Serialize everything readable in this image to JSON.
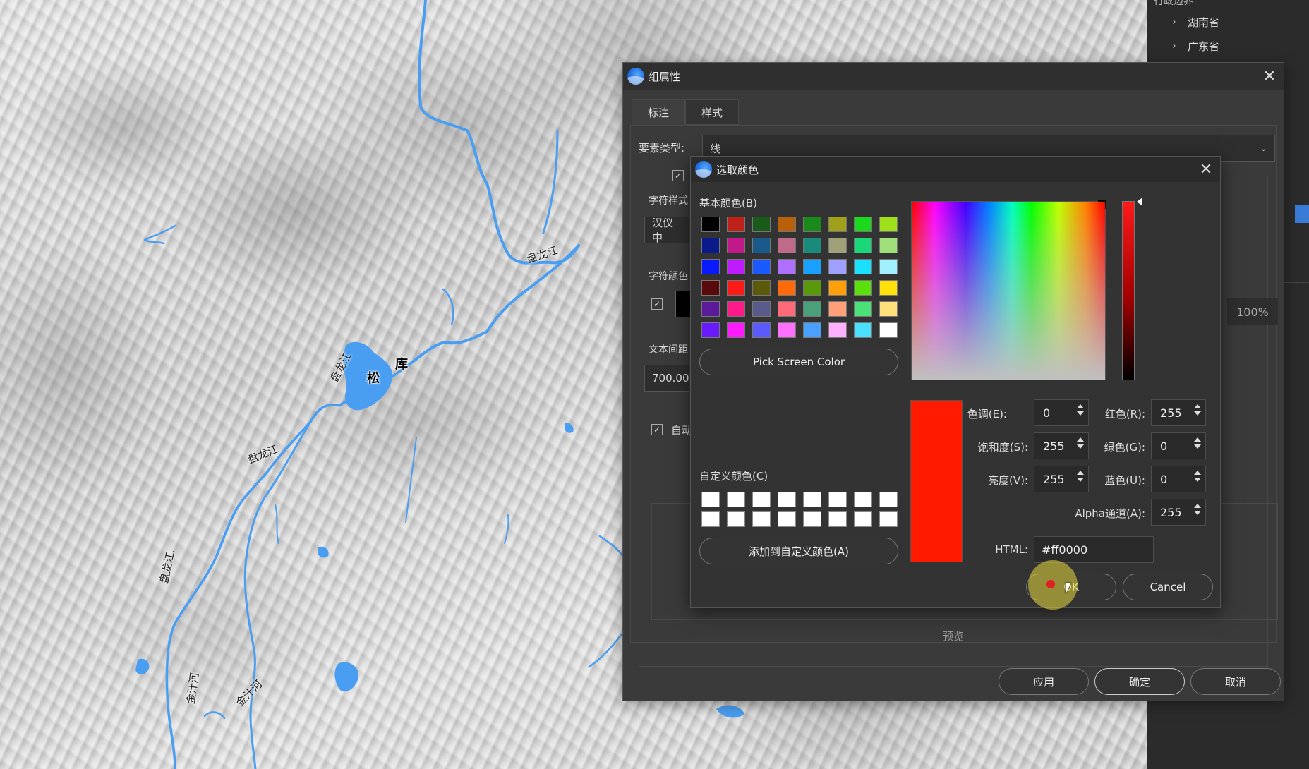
{
  "map": {
    "labels": {
      "river_panlong_1": "盘龙江",
      "river_panlong_2": "盘龙江",
      "river_panlong_3": "盘龙江",
      "river_panlong_4": "盘龙江.",
      "river_jinzhi_1": "金汁河",
      "river_jinzhi_2": "金汁河",
      "reservoir_1": "松",
      "reservoir_2": "库"
    },
    "river_color": "#4a9ef2"
  },
  "tree_panel": {
    "header": "行政边界",
    "items": [
      {
        "label": "湖南省"
      },
      {
        "label": "广东省"
      }
    ]
  },
  "group_dialog": {
    "title": "组属性",
    "tabs": [
      {
        "label": "标注",
        "active": true
      },
      {
        "label": "样式",
        "active": false
      }
    ],
    "feature_type_label": "要素类型:",
    "feature_type_value": "线",
    "char_style_label": "字符样式",
    "char_style_value": "汉仪中",
    "char_color_label": "字符颜色",
    "text_spacing_label": "文本间距",
    "text_spacing_value": "700.00",
    "auto_label": "自动",
    "opacity_value": "100%",
    "preview_label": "预览",
    "buttons": {
      "apply": "应用",
      "ok": "确定",
      "cancel": "取消"
    }
  },
  "color_dialog": {
    "title": "选取颜色",
    "basic_colors_label": "基本颜色(B)",
    "basic_colors": [
      "#000000",
      "#c0201a",
      "#1a5a1a",
      "#b8600a",
      "#1a8a1a",
      "#a0a01a",
      "#1ad81a",
      "#a0e01a",
      "#0a1a8a",
      "#c01a8a",
      "#1a5a8a",
      "#c06a8a",
      "#1a8a7a",
      "#a0a07a",
      "#1ad87a",
      "#a0e07a",
      "#0a1aff",
      "#c01aff",
      "#1a5aff",
      "#b070ff",
      "#1aa0ff",
      "#a0a0ff",
      "#1ae0ff",
      "#a0f0ff",
      "#5a0a0a",
      "#ff1a1a",
      "#5a5a0a",
      "#ff6a0a",
      "#5a9a0a",
      "#ffa00a",
      "#5ae00a",
      "#ffe00a",
      "#5a1a9a",
      "#ff1a8a",
      "#5a5a8a",
      "#ff6a7a",
      "#4aa07a",
      "#ffa07a",
      "#4ae07a",
      "#ffe07a",
      "#6a1aff",
      "#ff1aff",
      "#5a5aff",
      "#ff70ff",
      "#4aa0ff",
      "#ffb0ff",
      "#4ae0ff",
      "#ffffff"
    ],
    "pick_screen_color": "Pick Screen Color",
    "custom_colors_label": "自定义颜色(C)",
    "custom_colors": [
      "#ffffff",
      "#ffffff",
      "#ffffff",
      "#ffffff",
      "#ffffff",
      "#ffffff",
      "#ffffff",
      "#ffffff",
      "#ffffff",
      "#ffffff",
      "#ffffff",
      "#ffffff",
      "#ffffff",
      "#ffffff",
      "#ffffff",
      "#ffffff"
    ],
    "add_custom": "添加到自定义颜色(A)",
    "current_color": "#ff1a00",
    "fields": {
      "hue_label": "色调(E):",
      "hue": "0",
      "sat_label": "饱和度(S):",
      "sat": "255",
      "val_label": "亮度(V):",
      "val": "255",
      "red_label": "红色(R):",
      "red": "255",
      "green_label": "绿色(G):",
      "green": "0",
      "blue_label": "蓝色(U):",
      "blue": "0",
      "alpha_label": "Alpha通道(A):",
      "alpha": "255",
      "html_label": "HTML:",
      "html": "#ff0000"
    },
    "ok": "OK",
    "cancel": "Cancel"
  }
}
